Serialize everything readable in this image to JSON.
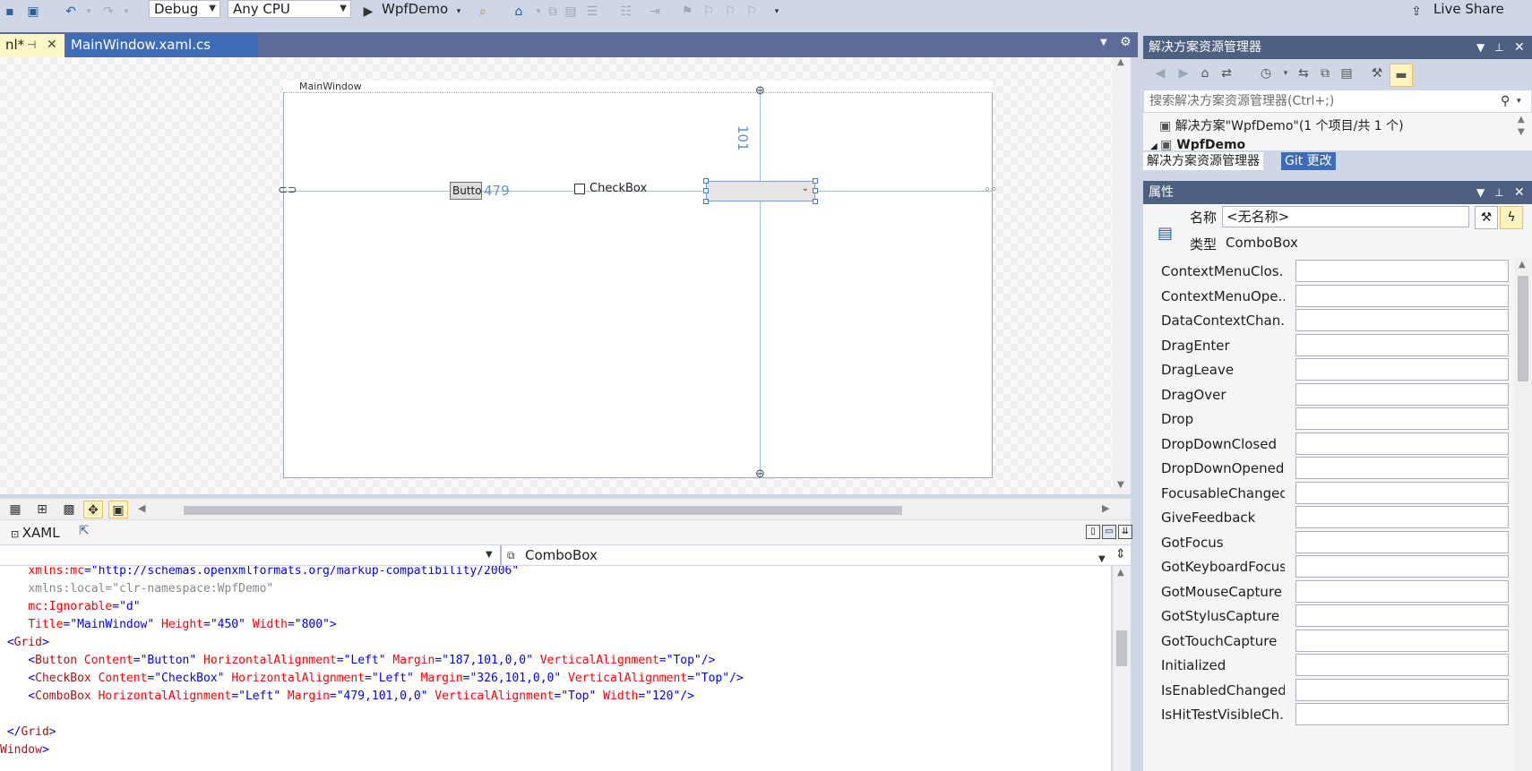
{
  "toolbar": {
    "config": "Debug",
    "platform": "Any CPU",
    "run_target": "WpfDemo",
    "live_share": "Live Share"
  },
  "tabs": [
    {
      "label": "nl*",
      "pin": "⊣",
      "close": "✕"
    },
    {
      "label": "MainWindow.xaml.cs"
    }
  ],
  "designer": {
    "window_title": "MainWindow",
    "button_text": "Button",
    "checkbox_text": "CheckBox",
    "margin_left": "479",
    "margin_top": "101"
  },
  "xaml": {
    "title": "XAML",
    "nav_right": "ComboBox",
    "lines": [
      {
        "indent": "    ",
        "parts": [
          {
            "t": "xmlns:mc",
            "c": "a"
          },
          {
            "t": "=",
            "c": "p"
          },
          {
            "t": "\"http://schemas.openxmlformats.org/markup-compatibility/2006\"",
            "c": "v"
          }
        ]
      },
      {
        "indent": "    ",
        "parts": [
          {
            "t": "xmlns:local",
            "c": "g"
          },
          {
            "t": "=",
            "c": "g"
          },
          {
            "t": "\"clr-namespace:WpfDemo\"",
            "c": "g"
          }
        ]
      },
      {
        "indent": "    ",
        "parts": [
          {
            "t": "mc:Ignorable",
            "c": "a"
          },
          {
            "t": "=",
            "c": "p"
          },
          {
            "t": "\"d\"",
            "c": "v"
          }
        ]
      },
      {
        "indent": "    ",
        "parts": [
          {
            "t": "Title",
            "c": "a"
          },
          {
            "t": "=",
            "c": "p"
          },
          {
            "t": "\"MainWindow\"",
            "c": "v"
          },
          {
            "t": " Height",
            "c": "a"
          },
          {
            "t": "=",
            "c": "p"
          },
          {
            "t": "\"450\"",
            "c": "v"
          },
          {
            "t": " Width",
            "c": "a"
          },
          {
            "t": "=",
            "c": "p"
          },
          {
            "t": "\"800\"",
            "c": "v"
          },
          {
            "t": ">",
            "c": "p"
          }
        ]
      },
      {
        "indent": " ",
        "parts": [
          {
            "t": "<",
            "c": "p"
          },
          {
            "t": "Grid",
            "c": "k"
          },
          {
            "t": ">",
            "c": "p"
          }
        ]
      },
      {
        "indent": "    ",
        "parts": [
          {
            "t": "<",
            "c": "p"
          },
          {
            "t": "Button",
            "c": "k"
          },
          {
            "t": " Content",
            "c": "a"
          },
          {
            "t": "=",
            "c": "p"
          },
          {
            "t": "\"Button\"",
            "c": "v"
          },
          {
            "t": " HorizontalAlignment",
            "c": "a"
          },
          {
            "t": "=",
            "c": "p"
          },
          {
            "t": "\"Left\"",
            "c": "v"
          },
          {
            "t": " Margin",
            "c": "a"
          },
          {
            "t": "=",
            "c": "p"
          },
          {
            "t": "\"187,101,0,0\"",
            "c": "v"
          },
          {
            "t": " VerticalAlignment",
            "c": "a"
          },
          {
            "t": "=",
            "c": "p"
          },
          {
            "t": "\"Top\"",
            "c": "v"
          },
          {
            "t": "/>",
            "c": "p"
          }
        ]
      },
      {
        "indent": "    ",
        "parts": [
          {
            "t": "<",
            "c": "p"
          },
          {
            "t": "CheckBox",
            "c": "k"
          },
          {
            "t": " Content",
            "c": "a"
          },
          {
            "t": "=",
            "c": "p"
          },
          {
            "t": "\"CheckBox\"",
            "c": "v"
          },
          {
            "t": " HorizontalAlignment",
            "c": "a"
          },
          {
            "t": "=",
            "c": "p"
          },
          {
            "t": "\"Left\"",
            "c": "v"
          },
          {
            "t": " Margin",
            "c": "a"
          },
          {
            "t": "=",
            "c": "p"
          },
          {
            "t": "\"326,101,0,0\"",
            "c": "v"
          },
          {
            "t": " VerticalAlignment",
            "c": "a"
          },
          {
            "t": "=",
            "c": "p"
          },
          {
            "t": "\"Top\"",
            "c": "v"
          },
          {
            "t": "/>",
            "c": "p"
          }
        ]
      },
      {
        "indent": "    ",
        "parts": [
          {
            "t": "<",
            "c": "p"
          },
          {
            "t": "ComboBox",
            "c": "k"
          },
          {
            "t": " HorizontalAlignment",
            "c": "a"
          },
          {
            "t": "=",
            "c": "p"
          },
          {
            "t": "\"Left\"",
            "c": "v"
          },
          {
            "t": " Margin",
            "c": "a"
          },
          {
            "t": "=",
            "c": "p"
          },
          {
            "t": "\"479,101,0,0\"",
            "c": "v"
          },
          {
            "t": " VerticalAlignment",
            "c": "a"
          },
          {
            "t": "=",
            "c": "p"
          },
          {
            "t": "\"Top\"",
            "c": "v"
          },
          {
            "t": " Width",
            "c": "a"
          },
          {
            "t": "=",
            "c": "p"
          },
          {
            "t": "\"120\"",
            "c": "v"
          },
          {
            "t": "/>",
            "c": "p"
          }
        ]
      },
      {
        "indent": "",
        "parts": []
      },
      {
        "indent": " ",
        "parts": [
          {
            "t": "</",
            "c": "p"
          },
          {
            "t": "Grid",
            "c": "k"
          },
          {
            "t": ">",
            "c": "p"
          }
        ]
      },
      {
        "indent": "",
        "parts": [
          {
            "t": "Window",
            "c": "k"
          },
          {
            "t": ">",
            "c": "p"
          }
        ]
      }
    ]
  },
  "solution": {
    "header": "解决方案资源管理器",
    "search_placeholder": "搜索解决方案资源管理器(Ctrl+;)",
    "tree_root": "解决方案\"WpfDemo\"(1 个项目/共 1 个)",
    "tree_project": "WpfDemo",
    "tab_active": "解决方案资源管理器",
    "tab_git": "Git 更改"
  },
  "properties": {
    "header": "属性",
    "name_label": "名称",
    "name_value": "<无名称>",
    "type_label": "类型",
    "type_value": "ComboBox",
    "events": [
      "ContextMenuClos...",
      "ContextMenuOpe...",
      "DataContextChan...",
      "DragEnter",
      "DragLeave",
      "DragOver",
      "Drop",
      "DropDownClosed",
      "DropDownOpened",
      "FocusableChanged",
      "GiveFeedback",
      "GotFocus",
      "GotKeyboardFocus",
      "GotMouseCapture",
      "GotStylusCapture",
      "GotTouchCapture",
      "Initialized",
      "IsEnabledChanged",
      "IsHitTestVisibleCh..."
    ]
  },
  "colors": {
    "accent": "#3e6db5",
    "pane_header": "#4d6082",
    "chrome": "#cfd6e5"
  }
}
